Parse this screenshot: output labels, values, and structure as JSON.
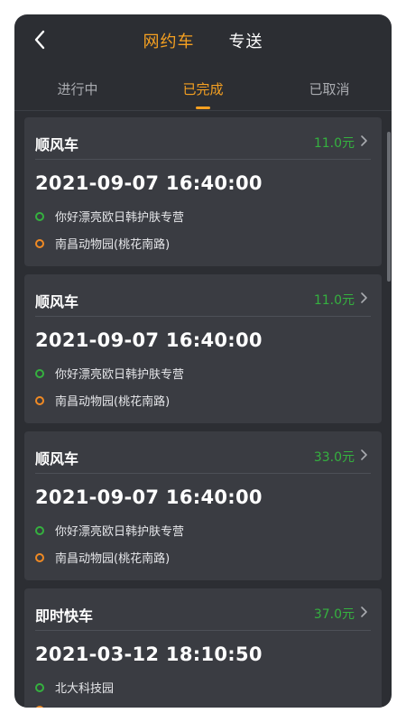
{
  "header": {
    "tabs": [
      {
        "label": "网约车",
        "active": true
      },
      {
        "label": "专送",
        "active": false
      }
    ]
  },
  "subtabs": [
    {
      "label": "进行中",
      "active": false
    },
    {
      "label": "已完成",
      "active": true
    },
    {
      "label": "已取消",
      "active": false
    }
  ],
  "orders": [
    {
      "type": "顺风车",
      "price": "11.0元",
      "time": "2021-09-07 16:40:00",
      "from": "你好漂亮欧日韩护肤专营",
      "to": "南昌动物园(桃花南路)"
    },
    {
      "type": "顺风车",
      "price": "11.0元",
      "time": "2021-09-07 16:40:00",
      "from": "你好漂亮欧日韩护肤专营",
      "to": "南昌动物园(桃花南路)"
    },
    {
      "type": "顺风车",
      "price": "33.0元",
      "time": "2021-09-07 16:40:00",
      "from": "你好漂亮欧日韩护肤专营",
      "to": "南昌动物园(桃花南路)"
    },
    {
      "type": "即时快车",
      "price": "37.0元",
      "time": "2021-03-12 18:10:50",
      "from": "北大科技园",
      "to": ""
    }
  ],
  "colors": {
    "accent": "#f5a021",
    "price": "#35b13f",
    "origin_dot": "#35b13f",
    "dest_dot": "#f08a24",
    "background": "#2c2e33",
    "card": "#3a3c42"
  },
  "icons": {
    "back": "chevron-left-icon",
    "card_arrow": "chevron-right-icon"
  }
}
